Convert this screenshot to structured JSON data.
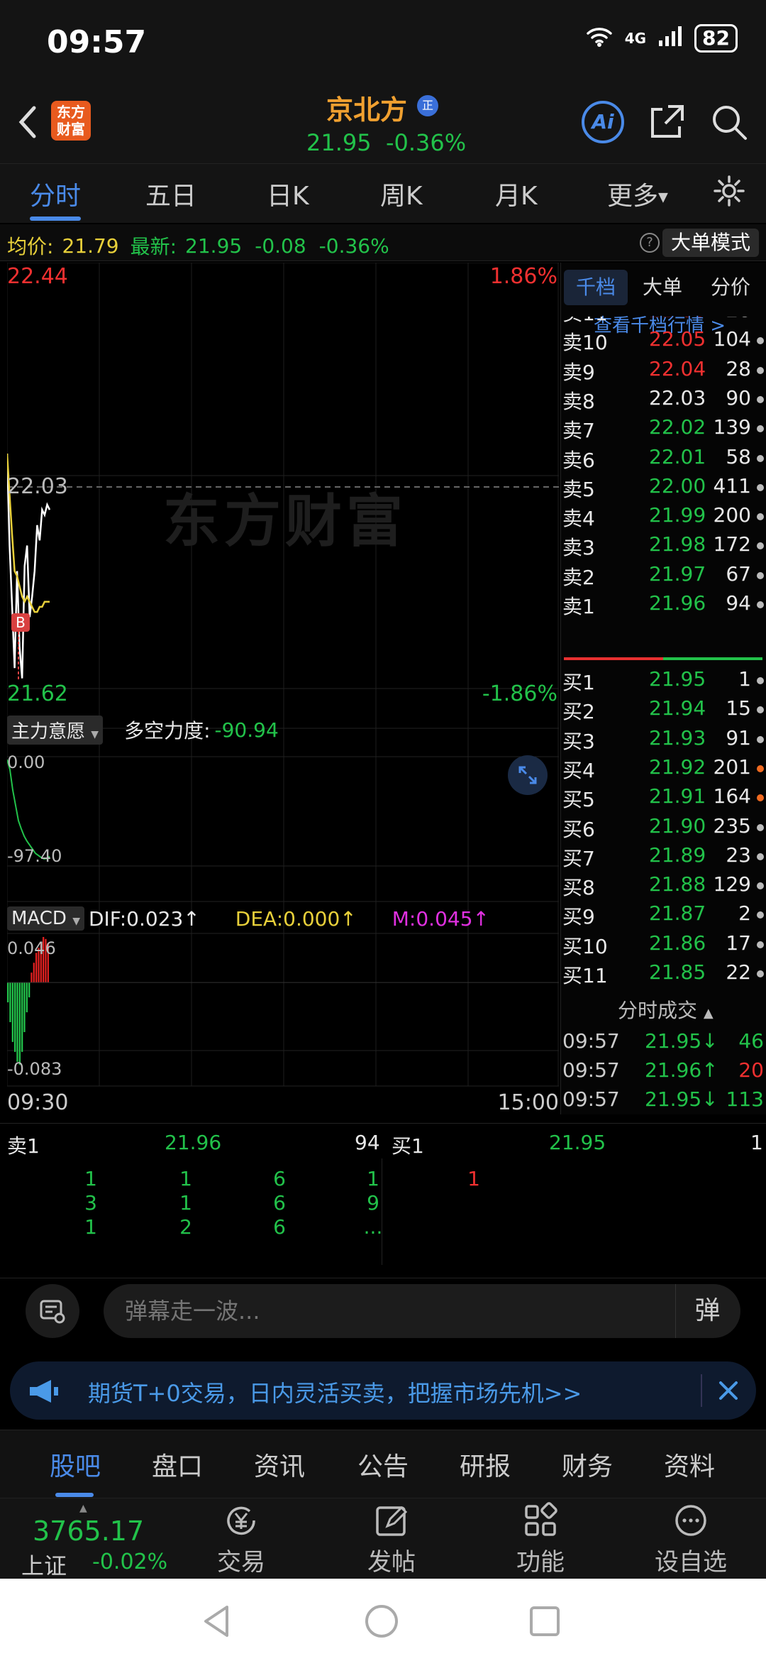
{
  "status_bar": {
    "time": "09:57",
    "net": "4G",
    "battery": "82"
  },
  "header": {
    "stock_name": "京北方",
    "badge": "正",
    "price": "21.95",
    "change_pct": "-0.36%",
    "ai_label": "Ai",
    "logo_text": "东方财富"
  },
  "chart_tabs": [
    "分时",
    "五日",
    "日K",
    "周K",
    "月K",
    "更多"
  ],
  "info_line": {
    "avg_label": "均价:",
    "avg_value": "21.79",
    "latest_label": "最新:",
    "latest_value": "21.95",
    "change": "-0.08",
    "change_pct": "-0.36%",
    "big_order_mode": "大单模式"
  },
  "watermark": "东方财富",
  "chart_data": [
    {
      "type": "line",
      "name": "intraday",
      "ylim": [
        21.62,
        22.44
      ],
      "y_ticks_left": [
        "22.44",
        "22.03",
        "21.62"
      ],
      "y_ticks_right": [
        "1.86%",
        "-1.86%"
      ],
      "x_ticks": [
        "09:30",
        "15:00"
      ],
      "series": [
        {
          "name": "price",
          "color": "#ffffff",
          "values": [
            22.08,
            21.9,
            21.78,
            21.66,
            21.85,
            21.7,
            21.64,
            21.86,
            21.9,
            21.76,
            21.8,
            21.85,
            21.94,
            21.91,
            21.97,
            21.96,
            21.98,
            21.97
          ]
        },
        {
          "name": "avg",
          "color": "#e8d03a",
          "values": [
            22.08,
            22.0,
            21.92,
            21.85,
            21.84,
            21.82,
            21.8,
            21.79,
            21.8,
            21.79,
            21.78,
            21.77,
            21.77,
            21.78,
            21.78,
            21.79,
            21.79,
            21.79
          ]
        }
      ]
    },
    {
      "type": "line",
      "name": "main-force-intent",
      "indicator_label": "主力意愿",
      "power_label": "多空力度:",
      "power_value": "-90.94",
      "ylim": [
        -97.4,
        0.0
      ],
      "y_ticks": [
        "0.00",
        "-97.40"
      ],
      "series": [
        {
          "name": "intent",
          "color": "#22c24a",
          "values": [
            0,
            -10,
            -30,
            -45,
            -60,
            -68,
            -75,
            -80,
            -84,
            -88,
            -92,
            -94,
            -96,
            -97.4,
            -97,
            -95
          ]
        }
      ]
    },
    {
      "type": "bar",
      "name": "macd",
      "indicator_label": "MACD",
      "dif": "DIF:0.023↑",
      "dea": "DEA:0.000↑",
      "m": "M:0.045↑",
      "ylim": [
        -0.083,
        0.046
      ],
      "y_ticks": [
        "0.046",
        "-0.083"
      ],
      "values": [
        -0.02,
        -0.04,
        -0.06,
        -0.07,
        -0.08,
        -0.083,
        -0.07,
        -0.05,
        -0.03,
        -0.015,
        0.01,
        0.02,
        0.03,
        0.035,
        0.04,
        0.046,
        0.044,
        0.04
      ]
    }
  ],
  "order_book": {
    "tabs": [
      "千档",
      "大单",
      "分价"
    ],
    "link": "查看千档行情 >",
    "asks": [
      {
        "label": "卖11",
        "price": "22.06",
        "vol": "28",
        "color": "r"
      },
      {
        "label": "卖10",
        "price": "22.05",
        "vol": "104",
        "color": "r"
      },
      {
        "label": "卖9",
        "price": "22.04",
        "vol": "28",
        "color": "r"
      },
      {
        "label": "卖8",
        "price": "22.03",
        "vol": "90",
        "color": "w"
      },
      {
        "label": "卖7",
        "price": "22.02",
        "vol": "139",
        "color": "g"
      },
      {
        "label": "卖6",
        "price": "22.01",
        "vol": "58",
        "color": "g"
      },
      {
        "label": "卖5",
        "price": "22.00",
        "vol": "411",
        "color": "g"
      },
      {
        "label": "卖4",
        "price": "21.99",
        "vol": "200",
        "color": "g"
      },
      {
        "label": "卖3",
        "price": "21.98",
        "vol": "172",
        "color": "g"
      },
      {
        "label": "卖2",
        "price": "21.97",
        "vol": "67",
        "color": "g"
      },
      {
        "label": "卖1",
        "price": "21.96",
        "vol": "94",
        "color": "g"
      }
    ],
    "bids": [
      {
        "label": "买1",
        "price": "21.95",
        "vol": "1",
        "color": "g",
        "dot": "#bbbbbb"
      },
      {
        "label": "买2",
        "price": "21.94",
        "vol": "15",
        "color": "g",
        "dot": "#bbbbbb"
      },
      {
        "label": "买3",
        "price": "21.93",
        "vol": "91",
        "color": "g",
        "dot": "#bbbbbb"
      },
      {
        "label": "买4",
        "price": "21.92",
        "vol": "201",
        "color": "g",
        "dot": "#f06a20"
      },
      {
        "label": "买5",
        "price": "21.91",
        "vol": "164",
        "color": "g",
        "dot": "#f06a20"
      },
      {
        "label": "买6",
        "price": "21.90",
        "vol": "235",
        "color": "g",
        "dot": "#bbbbbb"
      },
      {
        "label": "买7",
        "price": "21.89",
        "vol": "23",
        "color": "g",
        "dot": "#bbbbbb"
      },
      {
        "label": "买8",
        "price": "21.88",
        "vol": "129",
        "color": "g",
        "dot": "#bbbbbb"
      },
      {
        "label": "买9",
        "price": "21.87",
        "vol": "2",
        "color": "g",
        "dot": "#bbbbbb"
      },
      {
        "label": "买10",
        "price": "21.86",
        "vol": "17",
        "color": "g",
        "dot": "#bbbbbb"
      },
      {
        "label": "买11",
        "price": "21.85",
        "vol": "22",
        "color": "g",
        "dot": "#bbbbbb"
      }
    ],
    "trades_title": "分时成交",
    "trades": [
      {
        "time": "09:57",
        "price": "21.95↓",
        "vol": "46",
        "pc": "g",
        "vc": "g"
      },
      {
        "time": "09:57",
        "price": "21.96↑",
        "vol": "20",
        "pc": "g",
        "vc": "r"
      },
      {
        "time": "09:57",
        "price": "21.95↓",
        "vol": "113",
        "pc": "g",
        "vc": "g"
      }
    ]
  },
  "quote_bar": {
    "sell_label": "卖1",
    "sell_price": "21.96",
    "sell_vol": "94",
    "buy_label": "买1",
    "buy_price": "21.95",
    "buy_vol": "1"
  },
  "sell_queue": [
    [
      "1",
      "1",
      "6",
      "1"
    ],
    [
      "3",
      "1",
      "6",
      "9"
    ],
    [
      "1",
      "2",
      "6",
      "..."
    ]
  ],
  "buy_queue": [
    "1"
  ],
  "danmu": {
    "placeholder": "弹幕走一波...",
    "button": "弹"
  },
  "banner": {
    "text": "期货T+0交易，日内灵活买卖，把握市场先机>>"
  },
  "info_tabs": [
    "股吧",
    "盘口",
    "资讯",
    "公告",
    "研报",
    "财务",
    "资料"
  ],
  "index": {
    "value": "3765.17",
    "name": "上证",
    "change": "-0.02%"
  },
  "tabbar": [
    {
      "label": "交易",
      "icon": "yen-cycle-icon"
    },
    {
      "label": "发帖",
      "icon": "edit-icon"
    },
    {
      "label": "功能",
      "icon": "grid-icon"
    },
    {
      "label": "设自选",
      "icon": "more-icon"
    }
  ]
}
